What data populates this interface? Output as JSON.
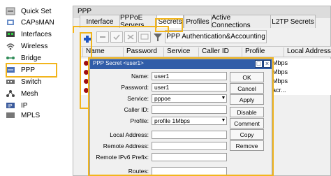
{
  "sidebar": {
    "items": [
      {
        "label": "Quick Set",
        "icon": "quick-set-icon"
      },
      {
        "label": "CAPsMAN",
        "icon": "capsman-icon"
      },
      {
        "label": "Interfaces",
        "icon": "interfaces-icon"
      },
      {
        "label": "Wireless",
        "icon": "wireless-icon"
      },
      {
        "label": "Bridge",
        "icon": "bridge-icon"
      },
      {
        "label": "PPP",
        "icon": "ppp-icon"
      },
      {
        "label": "Switch",
        "icon": "switch-icon"
      },
      {
        "label": "Mesh",
        "icon": "mesh-icon"
      },
      {
        "label": "IP",
        "icon": "ip-icon"
      },
      {
        "label": "MPLS",
        "icon": "mpls-icon"
      }
    ]
  },
  "ppp_window": {
    "title": "PPP",
    "tabs": [
      "Interface",
      "PPPoE Servers",
      "Secrets",
      "Profiles",
      "Active Connections",
      "L2TP Secrets"
    ],
    "active_tab": "Secrets",
    "auth_button": "PPP Authentication&Accounting",
    "table": {
      "columns": [
        "Name",
        "Password",
        "Service",
        "Caller ID",
        "Profile",
        "Local Address"
      ],
      "rows": [
        {
          "profile": "Mbps"
        },
        {
          "profile": "Mbps"
        },
        {
          "profile": "Mbps"
        },
        {
          "profile": "acr..."
        }
      ]
    }
  },
  "dialog": {
    "title": "PPP Secret <user1>",
    "fields": {
      "name": {
        "label": "Name:",
        "value": "user1"
      },
      "password": {
        "label": "Password:",
        "value": "user1"
      },
      "service": {
        "label": "Service:",
        "value": "pppoe"
      },
      "caller_id": {
        "label": "Caller ID:",
        "value": ""
      },
      "profile": {
        "label": "Profile:",
        "value": "profile 1Mbps"
      },
      "local_address": {
        "label": "Local Address:",
        "value": ""
      },
      "remote_address": {
        "label": "Remote Address:",
        "value": ""
      },
      "remote_ipv6_prefix": {
        "label": "Remote IPv6 Prefix:",
        "value": ""
      },
      "routes": {
        "label": "Routes:",
        "value": ""
      }
    },
    "buttons": [
      "OK",
      "Cancel",
      "Apply",
      "Disable",
      "Comment",
      "Copy",
      "Remove"
    ]
  },
  "colors": {
    "highlight": "#f2b51c",
    "dialog_title_bg": "#315da8"
  }
}
